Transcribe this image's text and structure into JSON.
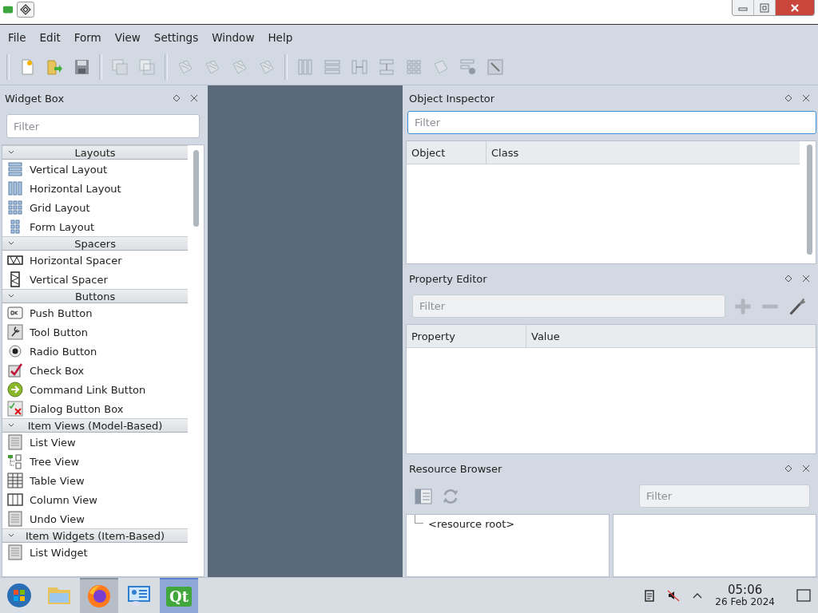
{
  "menu": [
    "File",
    "Edit",
    "Form",
    "View",
    "Settings",
    "Window",
    "Help"
  ],
  "widget_box": {
    "title": "Widget Box",
    "filter": {
      "placeholder": "Filter"
    },
    "categories": [
      {
        "title": "Layouts",
        "expanded": true,
        "items": [
          "Vertical Layout",
          "Horizontal Layout",
          "Grid Layout",
          "Form Layout"
        ]
      },
      {
        "title": "Spacers",
        "expanded": true,
        "items": [
          "Horizontal Spacer",
          "Vertical Spacer"
        ]
      },
      {
        "title": "Buttons",
        "expanded": true,
        "items": [
          "Push Button",
          "Tool Button",
          "Radio Button",
          "Check Box",
          "Command Link Button",
          "Dialog Button Box"
        ]
      },
      {
        "title": "Item Views (Model-Based)",
        "expanded": true,
        "items": [
          "List View",
          "Tree View",
          "Table View",
          "Column View",
          "Undo View"
        ]
      },
      {
        "title": "Item Widgets (Item-Based)",
        "expanded": true,
        "items": [
          "List Widget"
        ]
      }
    ]
  },
  "object_inspector": {
    "title": "Object Inspector",
    "filter": {
      "placeholder": "Filter"
    },
    "columns": [
      "Object",
      "Class"
    ]
  },
  "property_editor": {
    "title": "Property Editor",
    "filter": {
      "placeholder": "Filter"
    },
    "columns": [
      "Property",
      "Value"
    ]
  },
  "resource_browser": {
    "title": "Resource Browser",
    "filter": {
      "placeholder": "Filter"
    },
    "tree": [
      {
        "label": "<resource root>"
      }
    ]
  },
  "taskbar": {
    "apps": [
      {
        "kind": "start",
        "selected": false
      },
      {
        "kind": "folder",
        "selected": false
      },
      {
        "kind": "browser",
        "selected": true
      },
      {
        "kind": "remote",
        "selected": false
      },
      {
        "kind": "qt",
        "label": "Qt",
        "selected": true
      }
    ],
    "time": "05:06",
    "date": "26 Feb 2024"
  }
}
